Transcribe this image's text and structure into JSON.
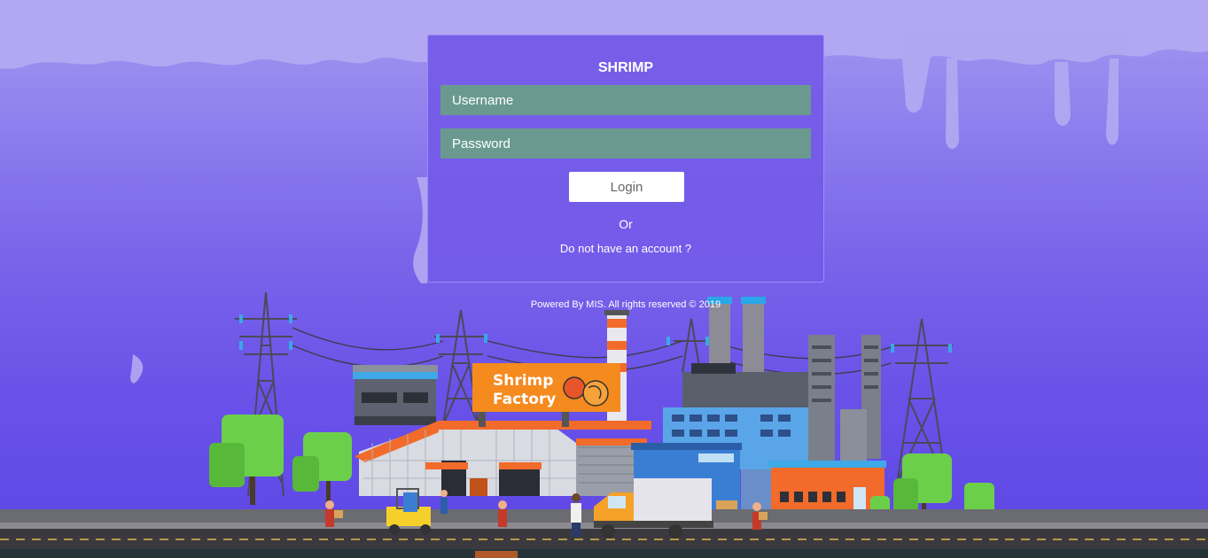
{
  "login": {
    "title": "SHRIMP",
    "username_placeholder": "Username",
    "password_placeholder": "Password",
    "login_label": "Login",
    "or_label": "Or",
    "signup_link": "Do not have an account ?"
  },
  "footer": {
    "text": "Powered By MIS. All rights reserved © 2019"
  },
  "illustration": {
    "sign_line1": "Shrimp",
    "sign_line2": "Factory"
  },
  "colors": {
    "background_top": "#a59af0",
    "background_bottom": "#5d45e6",
    "card": "#735ae8",
    "input": "#6a9a8f",
    "sign": "#f58a1f"
  }
}
